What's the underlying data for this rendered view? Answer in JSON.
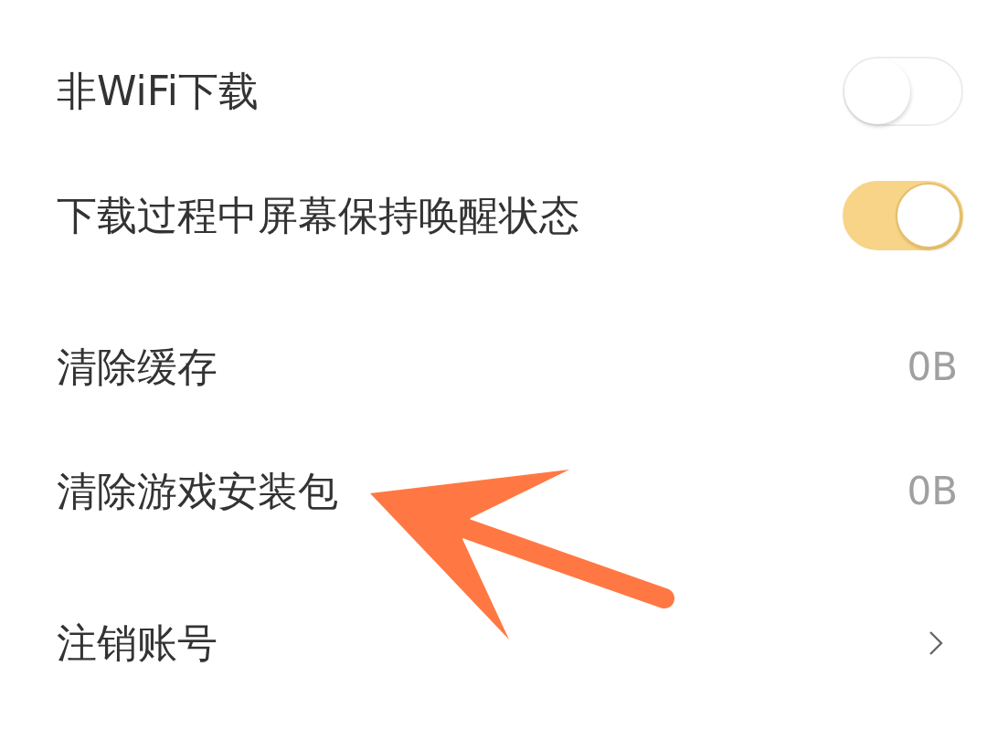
{
  "sections": [
    {
      "rows": [
        {
          "kind": "toggle",
          "label": "非WiFi下载",
          "on": false
        },
        {
          "kind": "toggle",
          "label": "下载过程中屏幕保持唤醒状态",
          "on": true
        }
      ]
    },
    {
      "rows": [
        {
          "kind": "value",
          "label": "清除缓存",
          "value": "0B"
        },
        {
          "kind": "value",
          "label": "清除游戏安装包",
          "value": "0B"
        }
      ]
    },
    {
      "rows": [
        {
          "kind": "link",
          "label": "注销账号"
        }
      ]
    }
  ]
}
